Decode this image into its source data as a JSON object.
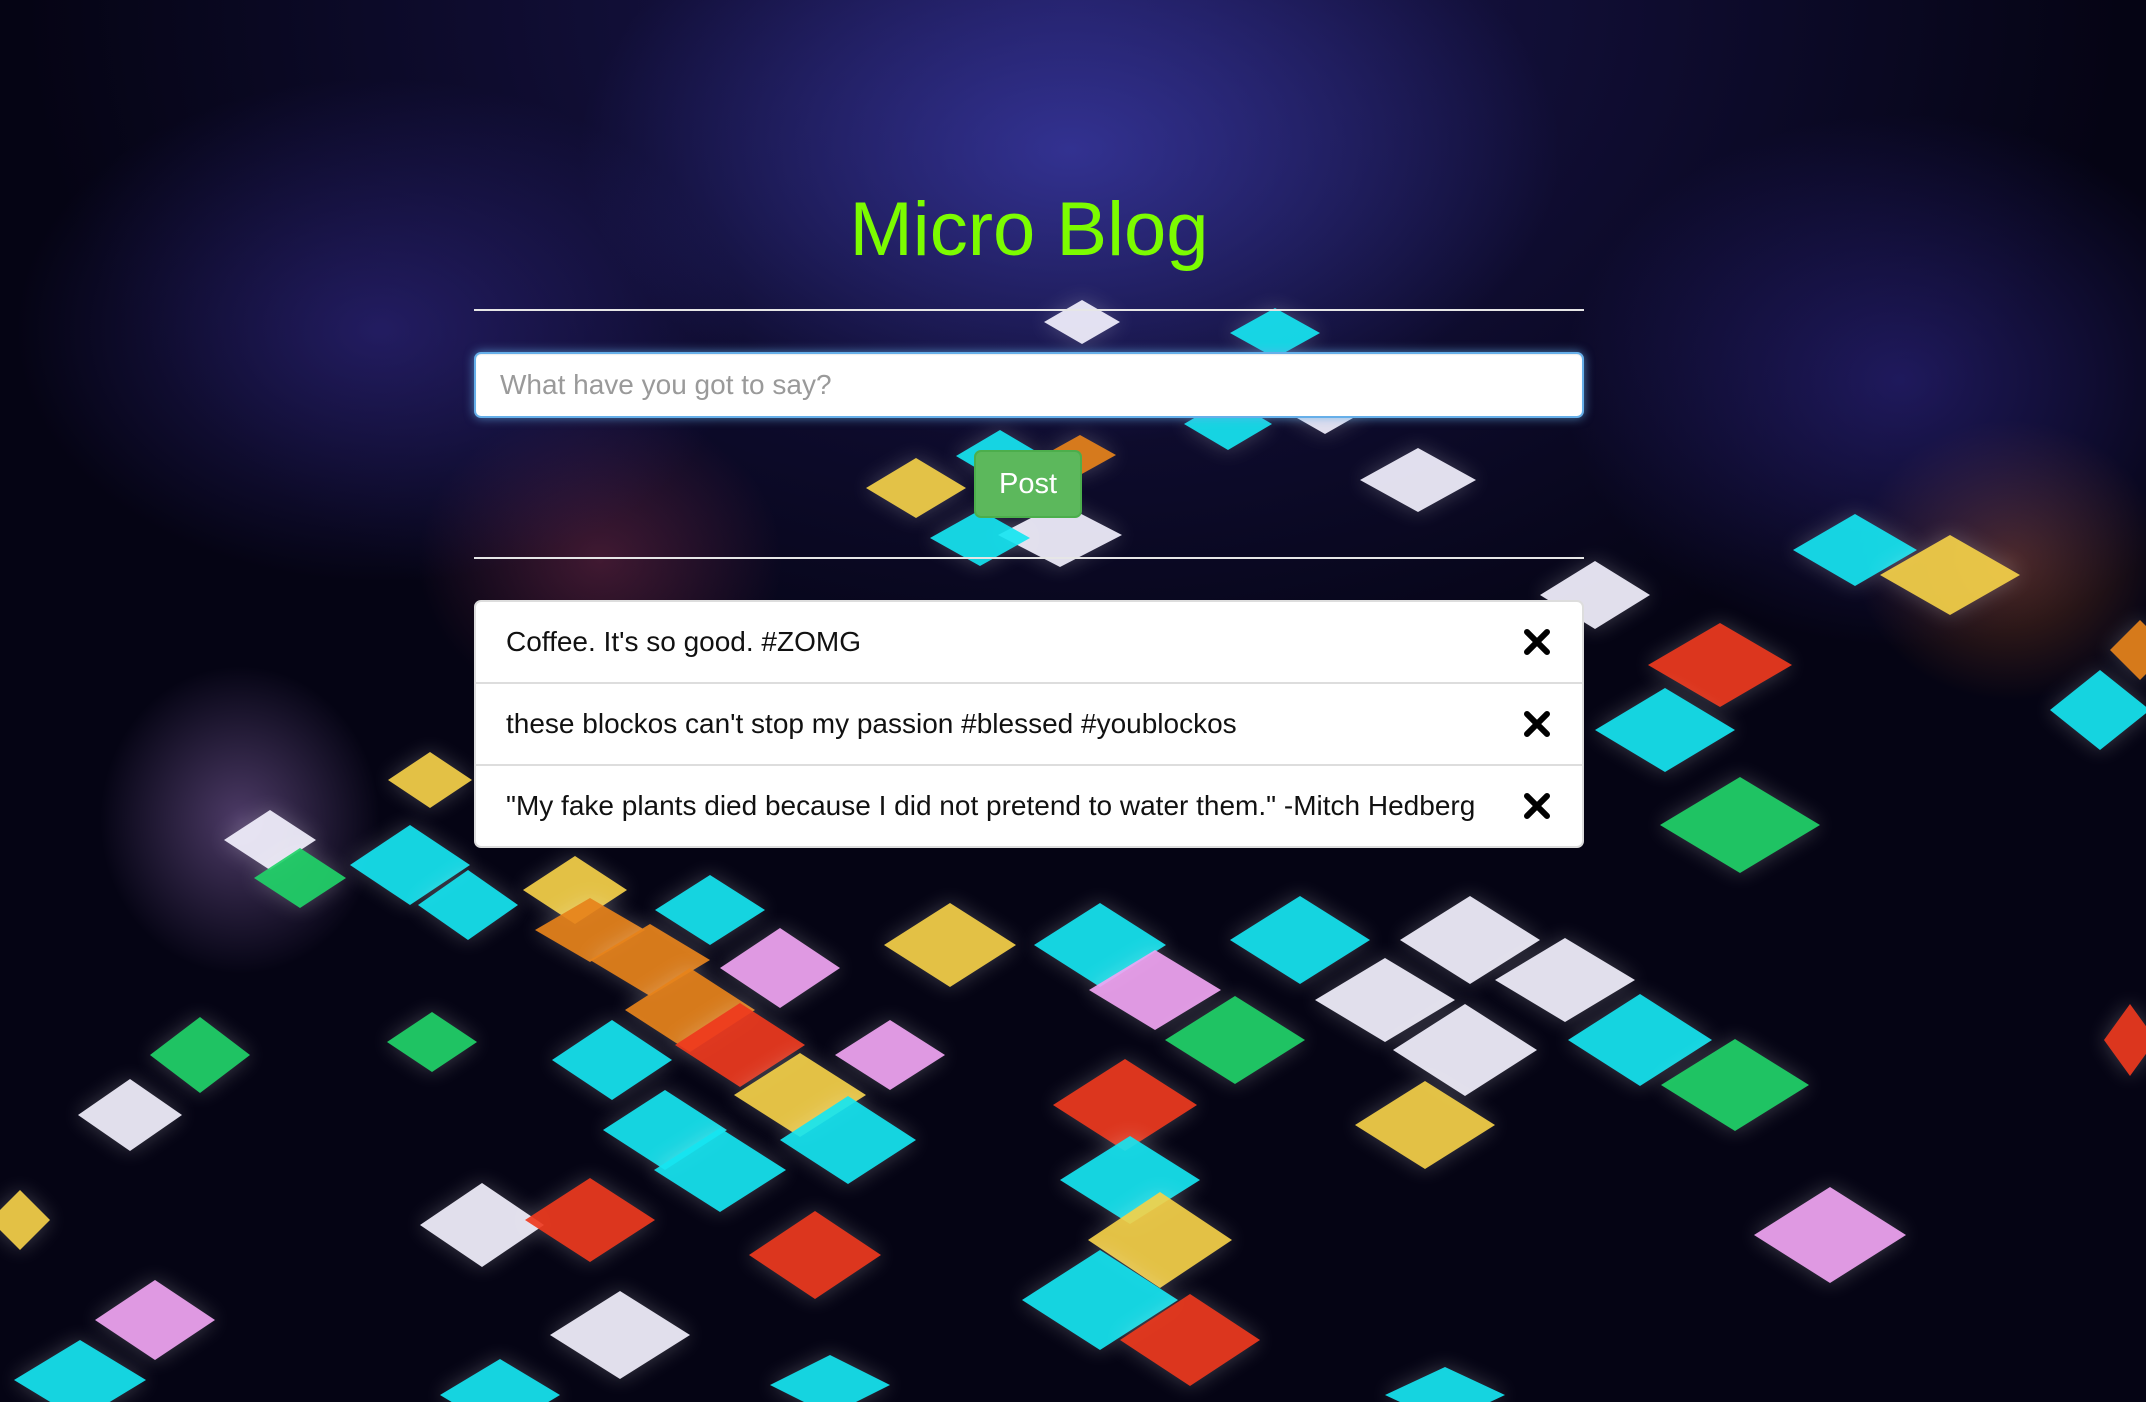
{
  "header": {
    "title": "Micro Blog"
  },
  "composer": {
    "placeholder": "What have you got to say?",
    "value": ""
  },
  "post_button": {
    "label": "Post"
  },
  "posts": [
    {
      "text": "Coffee. It's so good. #ZOMG",
      "delete_icon": "close-icon"
    },
    {
      "text": "these blockos can't stop my passion #blessed #youblockos",
      "delete_icon": "close-icon"
    },
    {
      "text": "\"My fake plants died because I did not pretend to water them.\" -Mitch Hedberg",
      "delete_icon": "close-icon"
    }
  ],
  "colors": {
    "title": "#7cfc00",
    "post_button": "#5cb85c",
    "input_focus": "#66afe9"
  },
  "background": {
    "description_icon": "disco-floor-background"
  }
}
